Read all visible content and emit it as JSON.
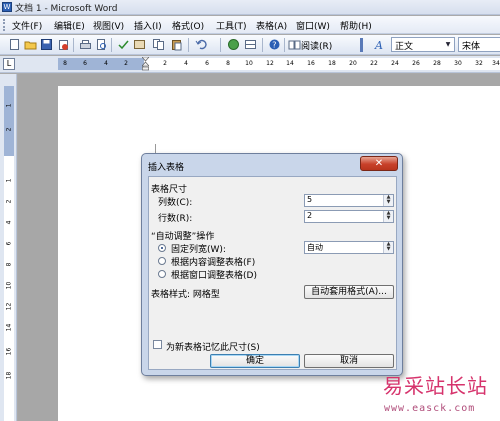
{
  "window": {
    "title": "文档 1 - Microsoft Word",
    "icon": "word-doc-icon"
  },
  "menubar": {
    "items": [
      "文件(F)",
      "编辑(E)",
      "视图(V)",
      "插入(I)",
      "格式(O)",
      "工具(T)",
      "表格(A)",
      "窗口(W)",
      "帮助(H)"
    ]
  },
  "toolbar": {
    "reading_label": "阅读(R)",
    "style_value": "正文",
    "font_value": "宋体",
    "icons": [
      "new-icon",
      "open-icon",
      "save-icon",
      "permission-icon",
      "print-icon",
      "print-preview-icon",
      "spelling-icon",
      "research-icon",
      "copy-icon",
      "paste-icon",
      "undo-icon",
      "hyperlink-icon",
      "help-icon",
      "reading-icon",
      "styles-icon"
    ]
  },
  "ruler": {
    "tab_selector": "L",
    "labels": [
      "8",
      "6",
      "4",
      "2",
      "2",
      "4",
      "6",
      "8",
      "10",
      "12",
      "14",
      "16",
      "18",
      "20",
      "22",
      "24",
      "26",
      "28",
      "30",
      "32",
      "34"
    ],
    "vertical_labels": [
      "1",
      "2",
      "1",
      "2",
      "4",
      "6",
      "8",
      "10",
      "12",
      "14",
      "16",
      "18"
    ]
  },
  "dialog": {
    "title": "插入表格",
    "close_glyph": "✕",
    "table_size": {
      "section_label": "表格尺寸",
      "columns_label": "列数(C):",
      "columns_value": "5",
      "rows_label": "行数(R):",
      "rows_value": "2"
    },
    "autofit": {
      "section_label": "“自动调整”操作",
      "options": [
        "固定列宽(W):",
        "根据内容调整表格(F)",
        "根据窗口调整表格(D)"
      ],
      "selected_index": 0,
      "column_width_value": "自动"
    },
    "table_style_label": "表格样式: 网格型",
    "autoformat_button": "自动套用格式(A)...",
    "remember_label": "为新表格记忆此尺寸(S)",
    "remember_checked": false,
    "ok_button": "确定",
    "cancel_button": "取消"
  },
  "watermark": {
    "chinese": "易采站长站",
    "url": "www.easck.com"
  },
  "colors": {
    "dialog_frame": "#c9d6ea",
    "close_button": "#c8412a",
    "watermark": "#d6336c"
  }
}
